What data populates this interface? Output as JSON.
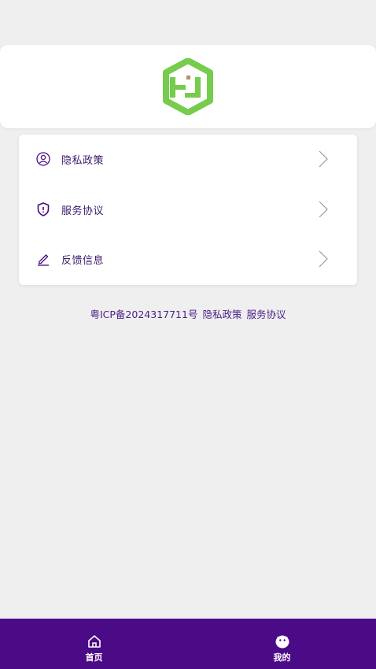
{
  "menu": {
    "items": [
      {
        "label": "隐私政策",
        "icon": "user-circle-icon"
      },
      {
        "label": "服务协议",
        "icon": "shield-icon"
      },
      {
        "label": "反馈信息",
        "icon": "edit-icon"
      }
    ]
  },
  "footer": {
    "icp": "粤ICP备2024317711号",
    "privacy_link": "隐私政策",
    "terms_link": "服务协议"
  },
  "tabbar": {
    "tabs": [
      {
        "label": "首页",
        "icon": "home-icon"
      },
      {
        "label": "我的",
        "icon": "profile-face-icon"
      }
    ]
  },
  "colors": {
    "brand": "#4b0a86",
    "text": "#3a1a6a",
    "logo_green": "#76cc4c",
    "background": "#efefef"
  }
}
